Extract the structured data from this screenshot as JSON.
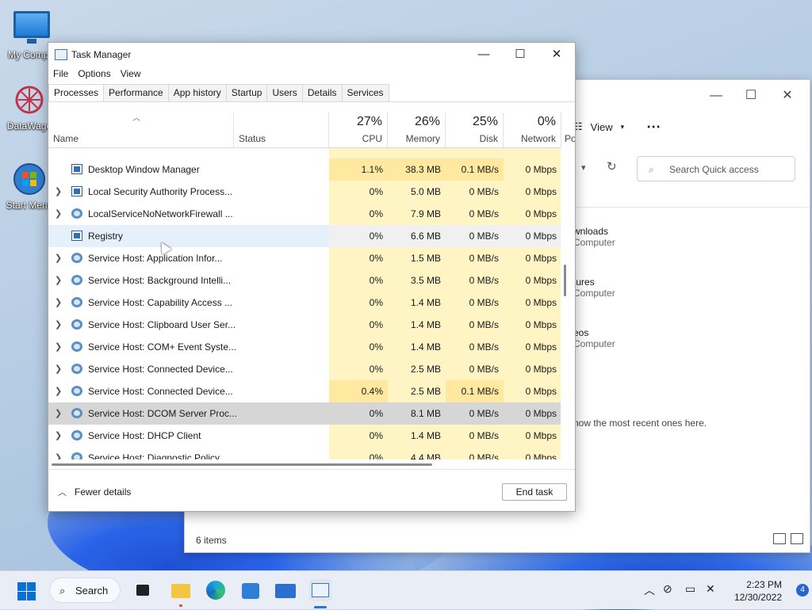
{
  "desktop": {
    "icons": [
      {
        "label": "My Compu"
      },
      {
        "label": "DataWago"
      },
      {
        "label": "Start Menu"
      }
    ]
  },
  "explorer": {
    "view_label": "View",
    "more_label": "⋯",
    "search_placeholder": "Search Quick access",
    "quick_items": [
      {
        "title": "wnloads",
        "sub": "Computer"
      },
      {
        "title": "tures",
        "sub": "Computer"
      },
      {
        "title": "eos",
        "sub": "Computer"
      }
    ],
    "recent_text": "how the most recent ones here.",
    "status_text": "6 items"
  },
  "task_manager": {
    "title": "Task Manager",
    "window_controls": {
      "minimize": "—",
      "maximize": "☐",
      "close": "✕"
    },
    "menu": [
      "File",
      "Options",
      "View"
    ],
    "tabs": [
      "Processes",
      "Performance",
      "App history",
      "Startup",
      "Users",
      "Details",
      "Services"
    ],
    "active_tab": "Processes",
    "columns": {
      "name": "Name",
      "status": "Status",
      "cpu": {
        "pct": "27%",
        "label": "CPU"
      },
      "memory": {
        "pct": "26%",
        "label": "Memory"
      },
      "disk": {
        "pct": "25%",
        "label": "Disk"
      },
      "network": {
        "pct": "0%",
        "label": "Network"
      },
      "power_partial": "Po"
    },
    "rows": [
      {
        "name": "Desktop Window Manager",
        "expandable": false,
        "icon": "window-icon",
        "cpu": "1.1%",
        "mem": "38.3 MB",
        "disk": "0.1 MB/s",
        "net": "0 Mbps"
      },
      {
        "name": "Local Security Authority Process...",
        "expandable": true,
        "icon": "window-icon",
        "cpu": "0%",
        "mem": "5.0 MB",
        "disk": "0 MB/s",
        "net": "0 Mbps"
      },
      {
        "name": "LocalServiceNoNetworkFirewall ...",
        "expandable": true,
        "icon": "gear-icon",
        "cpu": "0%",
        "mem": "7.9 MB",
        "disk": "0 MB/s",
        "net": "0 Mbps"
      },
      {
        "name": "Registry",
        "expandable": false,
        "icon": "window-icon",
        "cpu": "0%",
        "mem": "6.6 MB",
        "disk": "0 MB/s",
        "net": "0 Mbps"
      },
      {
        "name": "Service Host: Application Infor...",
        "expandable": true,
        "icon": "gear-icon",
        "cpu": "0%",
        "mem": "1.5 MB",
        "disk": "0 MB/s",
        "net": "0 Mbps"
      },
      {
        "name": "Service Host: Background Intelli...",
        "expandable": true,
        "icon": "gear-icon",
        "cpu": "0%",
        "mem": "3.5 MB",
        "disk": "0 MB/s",
        "net": "0 Mbps"
      },
      {
        "name": "Service Host: Capability Access ...",
        "expandable": true,
        "icon": "gear-icon",
        "cpu": "0%",
        "mem": "1.4 MB",
        "disk": "0 MB/s",
        "net": "0 Mbps"
      },
      {
        "name": "Service Host: Clipboard User Ser...",
        "expandable": true,
        "icon": "gear-icon",
        "cpu": "0%",
        "mem": "1.4 MB",
        "disk": "0 MB/s",
        "net": "0 Mbps"
      },
      {
        "name": "Service Host: COM+ Event Syste...",
        "expandable": true,
        "icon": "gear-icon",
        "cpu": "0%",
        "mem": "1.4 MB",
        "disk": "0 MB/s",
        "net": "0 Mbps"
      },
      {
        "name": "Service Host: Connected Device...",
        "expandable": true,
        "icon": "gear-icon",
        "cpu": "0%",
        "mem": "2.5 MB",
        "disk": "0 MB/s",
        "net": "0 Mbps"
      },
      {
        "name": "Service Host: Connected Device...",
        "expandable": true,
        "icon": "gear-icon",
        "cpu": "0.4%",
        "mem": "2.5 MB",
        "disk": "0.1 MB/s",
        "net": "0 Mbps"
      },
      {
        "name": "Service Host: DCOM Server Proc...",
        "expandable": true,
        "icon": "gear-icon",
        "cpu": "0%",
        "mem": "8.1 MB",
        "disk": "0 MB/s",
        "net": "0 Mbps"
      },
      {
        "name": "Service Host: DHCP Client",
        "expandable": true,
        "icon": "gear-icon",
        "cpu": "0%",
        "mem": "1.4 MB",
        "disk": "0 MB/s",
        "net": "0 Mbps"
      },
      {
        "name": "Service Host: Diagnostic Policy ...",
        "expandable": true,
        "icon": "gear-icon",
        "cpu": "0%",
        "mem": "4.4 MB",
        "disk": "0 MB/s",
        "net": "0 Mbps"
      }
    ],
    "fewer_details": "Fewer details",
    "end_task": "End task"
  },
  "taskbar": {
    "search_label": "Search",
    "time": "2:23 PM",
    "date": "12/30/2022",
    "notification_count": "4"
  }
}
